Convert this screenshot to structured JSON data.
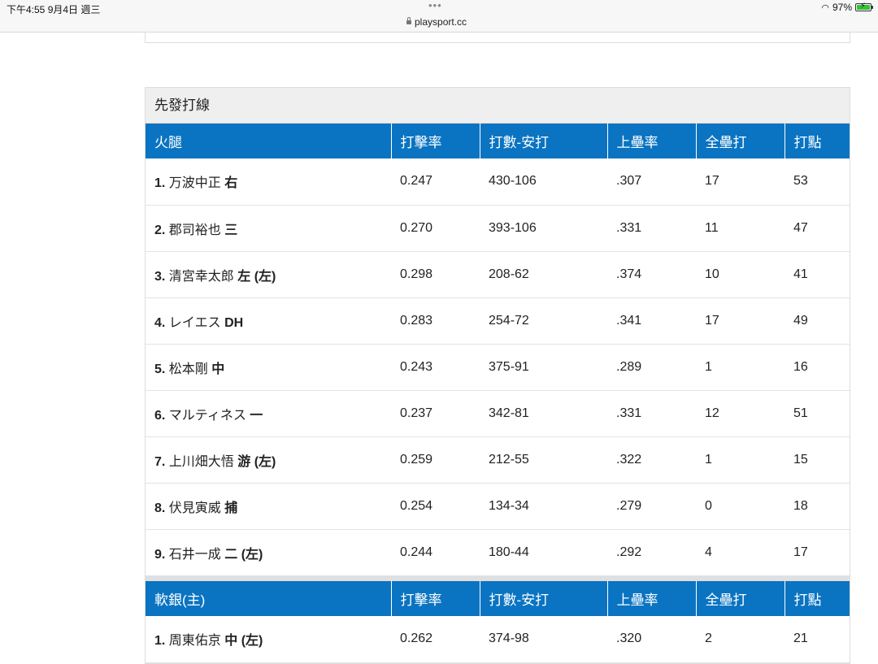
{
  "status_bar": {
    "time_date": "下午4:55  9月4日 週三",
    "dots": "•••",
    "url": "playsport.cc",
    "battery": "97%"
  },
  "lineup": {
    "title": "先發打線",
    "teams": [
      {
        "name": "火腿",
        "headers": [
          "打擊率",
          "打數-安打",
          "上壘率",
          "全壘打",
          "打點"
        ],
        "players": [
          {
            "order": "1.",
            "name": "万波中正",
            "pos": "右",
            "avg": "0.247",
            "ab_h": "430-106",
            "obp": ".307",
            "hr": "17",
            "rbi": "53"
          },
          {
            "order": "2.",
            "name": "郡司裕也",
            "pos": "三",
            "avg": "0.270",
            "ab_h": "393-106",
            "obp": ".331",
            "hr": "11",
            "rbi": "47"
          },
          {
            "order": "3.",
            "name": "清宮幸太郎",
            "pos": "左 (左)",
            "avg": "0.298",
            "ab_h": "208-62",
            "obp": ".374",
            "hr": "10",
            "rbi": "41"
          },
          {
            "order": "4.",
            "name": "レイエス",
            "pos": "DH",
            "avg": "0.283",
            "ab_h": "254-72",
            "obp": ".341",
            "hr": "17",
            "rbi": "49"
          },
          {
            "order": "5.",
            "name": "松本剛",
            "pos": "中",
            "avg": "0.243",
            "ab_h": "375-91",
            "obp": ".289",
            "hr": "1",
            "rbi": "16"
          },
          {
            "order": "6.",
            "name": "マルティネス",
            "pos": "一",
            "avg": "0.237",
            "ab_h": "342-81",
            "obp": ".331",
            "hr": "12",
            "rbi": "51"
          },
          {
            "order": "7.",
            "name": "上川畑大悟",
            "pos": "游 (左)",
            "avg": "0.259",
            "ab_h": "212-55",
            "obp": ".322",
            "hr": "1",
            "rbi": "15"
          },
          {
            "order": "8.",
            "name": "伏見寅威",
            "pos": "捕",
            "avg": "0.254",
            "ab_h": "134-34",
            "obp": ".279",
            "hr": "0",
            "rbi": "18"
          },
          {
            "order": "9.",
            "name": "石井一成",
            "pos": "二 (左)",
            "avg": "0.244",
            "ab_h": "180-44",
            "obp": ".292",
            "hr": "4",
            "rbi": "17"
          }
        ]
      },
      {
        "name": "軟銀(主)",
        "headers": [
          "打擊率",
          "打數-安打",
          "上壘率",
          "全壘打",
          "打點"
        ],
        "players": [
          {
            "order": "1.",
            "name": "周東佑京",
            "pos": "中 (左)",
            "avg": "0.262",
            "ab_h": "374-98",
            "obp": ".320",
            "hr": "2",
            "rbi": "21"
          }
        ]
      }
    ]
  }
}
